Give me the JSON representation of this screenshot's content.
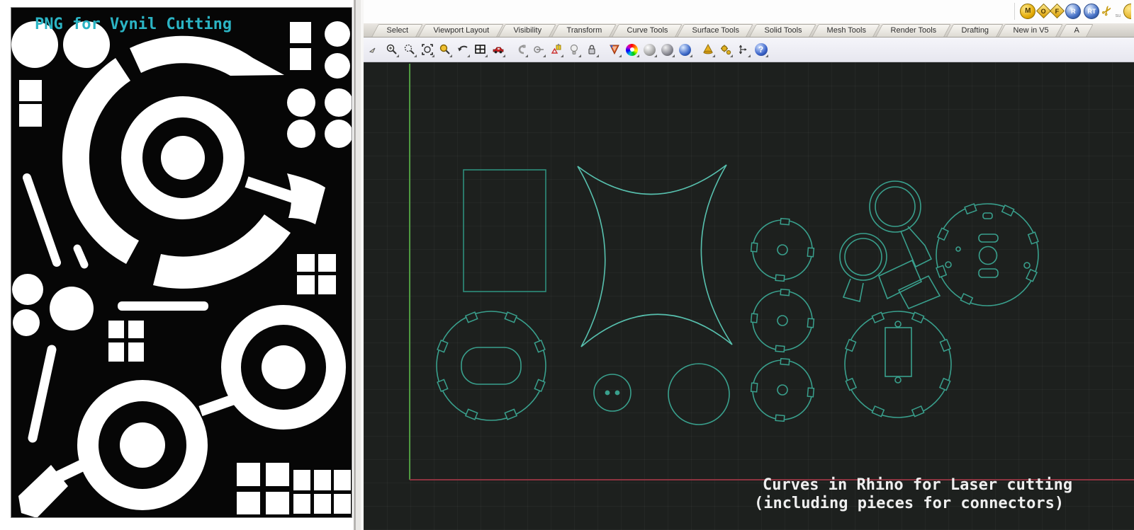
{
  "left_panel": {
    "title": "PNG for Vynil Cutting",
    "title_color": "#2bb4c4",
    "background_color": "#060606",
    "shape_color": "#ffffff"
  },
  "rhino": {
    "titlebar": {
      "plugin_icons": [
        {
          "label": "M"
        },
        {
          "label": "O"
        },
        {
          "label": "F"
        },
        {
          "label": "R"
        },
        {
          "label": "RT"
        }
      ],
      "scissors_glyph": "✂",
      "side_text": "su"
    },
    "tab_bar": {
      "tabs": [
        "Select",
        "Viewport Layout",
        "Visibility",
        "Transform",
        "Curve Tools",
        "Surface Tools",
        "Solid Tools",
        "Mesh Tools",
        "Render Tools",
        "Drafting",
        "New in V5",
        "A"
      ]
    },
    "toolbar": {
      "help_glyph": "?",
      "icons": [
        "pointer-icon",
        "zoom-in-icon",
        "zoom-window-icon",
        "zoom-extents-icon",
        "zoom-selected-icon",
        "undo-view-icon",
        "viewport-layout-icon",
        "car-icon",
        "clamp-icon",
        "orient-circle-icon",
        "move-widget-icon",
        "lamp-icon",
        "lock-icon",
        "render-shield-icon",
        "color-wheel-icon",
        "shaded-sphere-icon",
        "rendered-sphere-icon",
        "raytrace-sphere-icon",
        "cone-icon",
        "options-gears-icon",
        "dimension-icon",
        "help-icon"
      ]
    },
    "viewport": {
      "background_color": "#1d201e",
      "curve_color": "#39a08d",
      "x_axis_color": "#8c3340",
      "y_axis_color": "#4f9a40",
      "caption_line1": "Curves in Rhino for Laser cutting",
      "caption_line2": "(including pieces for connectors)"
    }
  }
}
